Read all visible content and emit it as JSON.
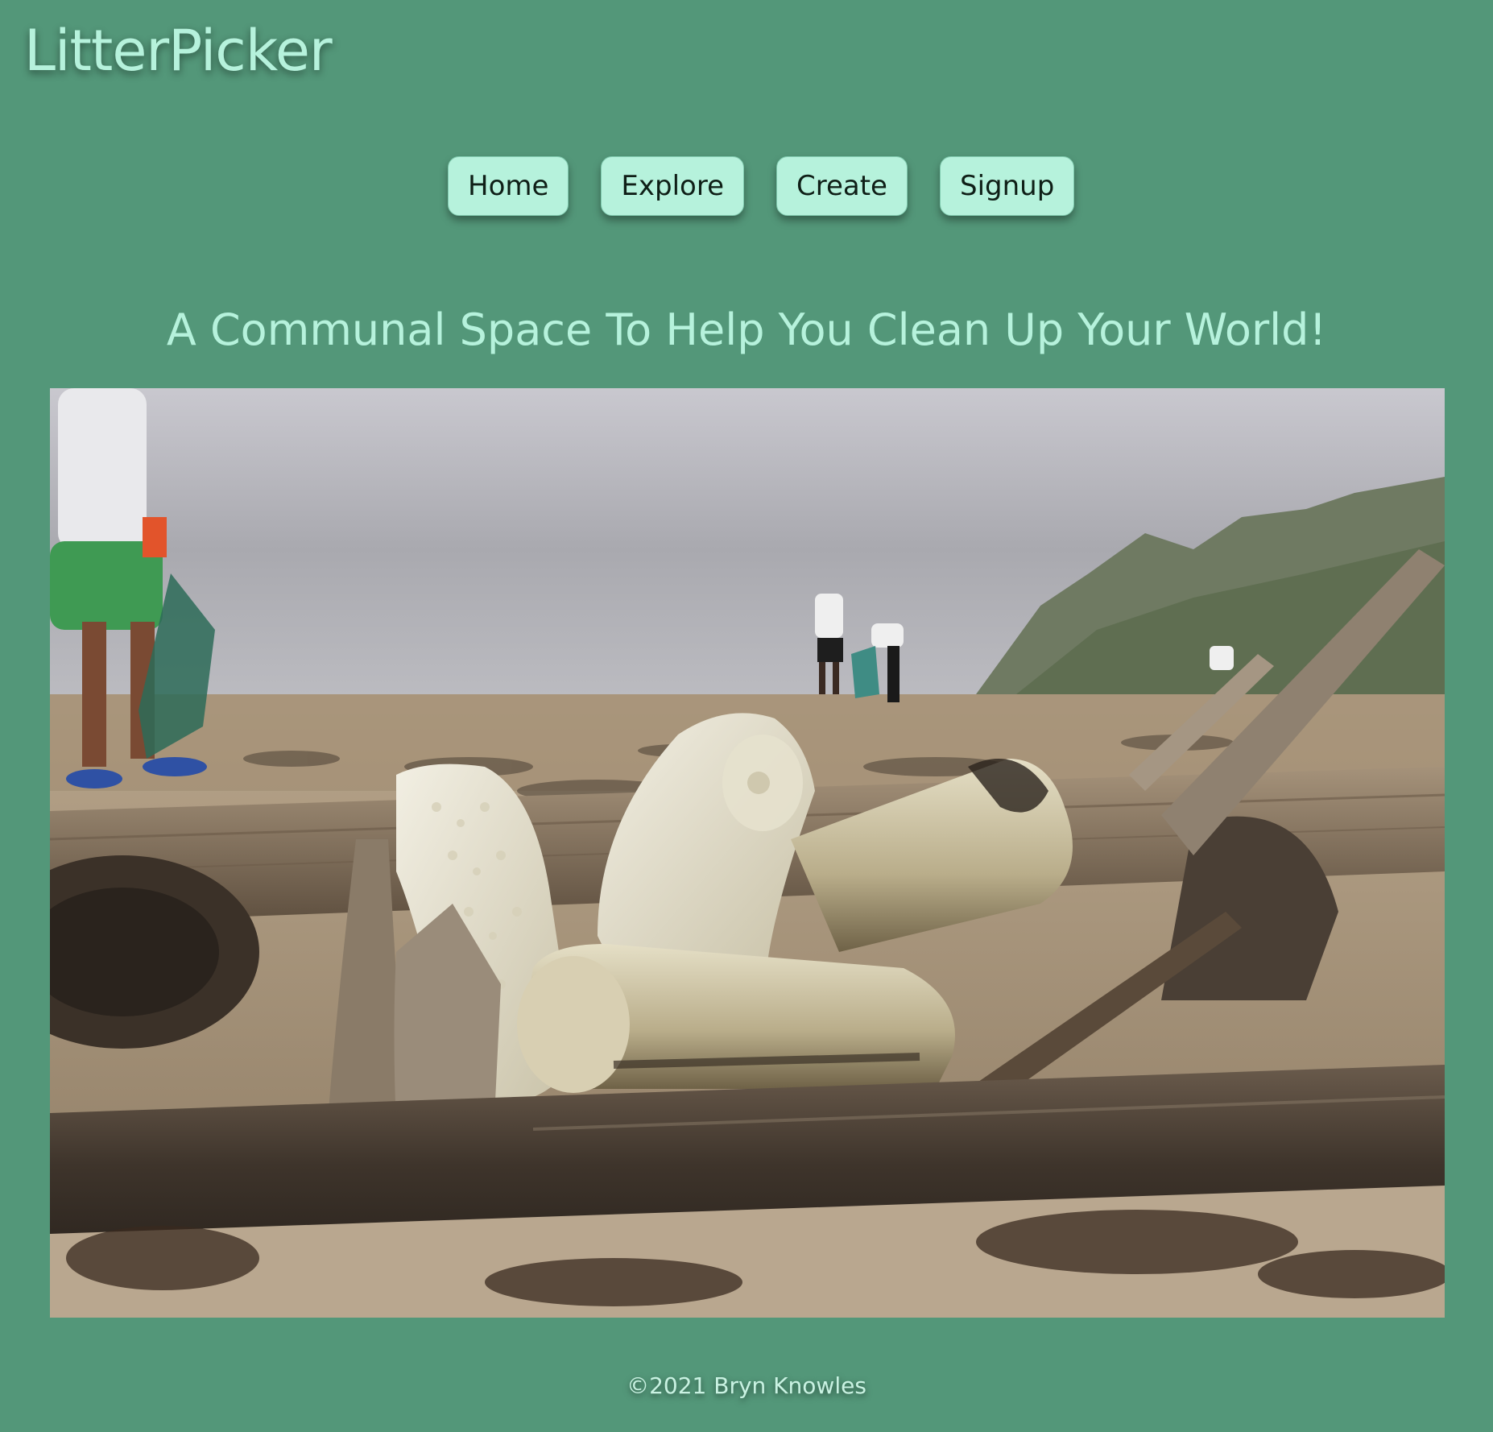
{
  "header": {
    "brand": "LitterPicker"
  },
  "nav": {
    "items": [
      {
        "label": "Home"
      },
      {
        "label": "Explore"
      },
      {
        "label": "Create"
      },
      {
        "label": "Signup"
      }
    ]
  },
  "main": {
    "headline": "A Communal Space To Help You Clean Up Your World!"
  },
  "footer": {
    "copyright": "©2021 Bryn Knowles"
  },
  "colors": {
    "background": "#539779",
    "accent": "#b6f2dc",
    "button_text": "#0f1f17"
  }
}
